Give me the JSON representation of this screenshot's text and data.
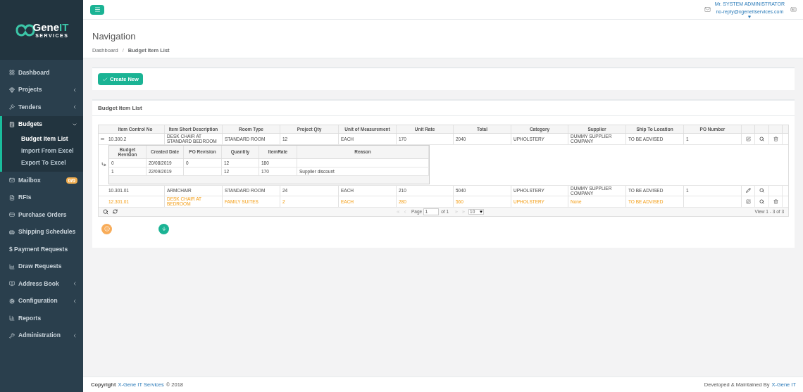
{
  "logo": {
    "name_part": "Gene",
    "name_accent": "IT",
    "tagline": "SERVICES"
  },
  "sidebar": {
    "items": [
      {
        "label": "Dashboard",
        "has_submenu": false,
        "selected": false
      },
      {
        "label": "Projects",
        "has_submenu": true,
        "expanded": false,
        "selected": false
      },
      {
        "label": "Tenders",
        "has_submenu": true,
        "expanded": false,
        "selected": false
      },
      {
        "label": "Budgets",
        "has_submenu": true,
        "expanded": true,
        "selected": true,
        "children": [
          {
            "label": "Budget Item List",
            "selected": true
          },
          {
            "label": "Import From Excel",
            "selected": false
          },
          {
            "label": "Export To Excel",
            "selected": false
          }
        ]
      },
      {
        "label": "Mailbox",
        "has_submenu": false,
        "selected": false,
        "badge": "0/0"
      },
      {
        "label": "RFIs",
        "has_submenu": false,
        "selected": false
      },
      {
        "label": "Purchase Orders",
        "has_submenu": false,
        "selected": false
      },
      {
        "label": "Shipping Schedules",
        "has_submenu": false,
        "selected": false
      },
      {
        "label": "$ Payment Requests",
        "has_submenu": false,
        "selected": false
      },
      {
        "label": "Draw Requests",
        "has_submenu": false,
        "selected": false
      },
      {
        "label": "Address Book",
        "has_submenu": true,
        "expanded": false,
        "selected": false
      },
      {
        "label": "Configuration",
        "has_submenu": true,
        "expanded": false,
        "selected": false
      },
      {
        "label": "Reports",
        "has_submenu": false,
        "selected": false
      },
      {
        "label": "Administration",
        "has_submenu": true,
        "expanded": false,
        "selected": false
      }
    ]
  },
  "user": {
    "name": "Mr. SYSTEM ADMINISTRATOR",
    "email": "no-reply@xgeneitservices.com"
  },
  "page": {
    "title": "Navigation",
    "breadcrumb": [
      "Dashboard",
      "Budget Item List"
    ],
    "separator": "/"
  },
  "create_button": "Create New",
  "panel_title": "Budget Item List",
  "table": {
    "columns": [
      "Item Control No",
      "Item Short Description",
      "Room Type",
      "Project Qty",
      "Unit of Measurement",
      "Unit Rate",
      "Total",
      "Category",
      "Supplier",
      "Ship To Location",
      "PO Number"
    ],
    "rows": [
      {
        "kind": "full",
        "cells": [
          "10.300.2",
          "DESK CHAIR AT STANDARD BEDROOM",
          "STANDARD ROOM",
          "12",
          "EACH",
          "170",
          "2040",
          "UPHOLSTERY",
          "DUMMY SUPPLIER COMPANY",
          "TO BE ADVISED",
          "1"
        ],
        "highlighted": false,
        "expanded": true,
        "subgrid": {
          "columns": [
            "Budget Revision",
            "Created Date",
            "PO Revision",
            "Quantity",
            "ItemRate",
            "Reason"
          ],
          "rows": [
            [
              "0",
              "20/08/2019",
              "0",
              "12",
              "180",
              ""
            ],
            [
              "1",
              "22/09/2019",
              "",
              "12",
              "170",
              "Supplier discount"
            ]
          ]
        }
      },
      {
        "kind": "limited",
        "cells": [
          "10.301.01",
          "ARMCHAIR",
          "STANDARD ROOM",
          "24",
          "EACH",
          "210",
          "5040",
          "UPHOLSTERY",
          "DUMMY SUPPLIER COMPANY",
          "TO BE ADVISED",
          "1"
        ],
        "highlighted": false,
        "expanded": false
      },
      {
        "kind": "full",
        "cells": [
          "12.301.01",
          "DESK CHAIR AT BEDROOM",
          "FAMILY SUITES",
          "2",
          "EACH",
          "280",
          "560",
          "UPHOLSTERY",
          "None",
          "TO BE ADVISED",
          ""
        ],
        "highlighted": true,
        "expanded": false
      }
    ]
  },
  "pager": {
    "page_label": "Page",
    "page": "1",
    "of": "of 1",
    "page_size": "10",
    "summary": "View 1 - 3 of 3"
  },
  "footer": {
    "left_prefix": "Copyright",
    "left_link": "X-Gene IT Services",
    "left_suffix": "© 2018",
    "right_prefix": "Developed & Maintained By",
    "right_link": "X-Gene IT"
  }
}
